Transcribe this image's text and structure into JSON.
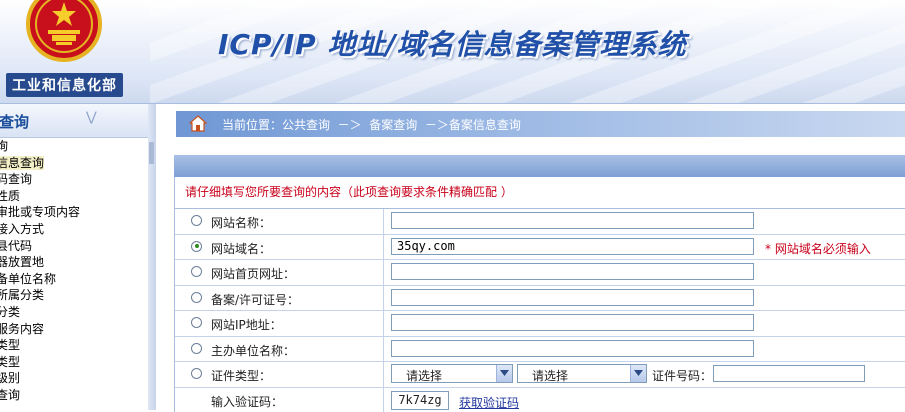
{
  "header": {
    "ministry": "工业和信息化部",
    "system_title": "ICP/IP 地址/域名信息备案管理系统"
  },
  "sidebar": {
    "title": "查询",
    "items": [
      {
        "label": "询"
      },
      {
        "label": "信息查询",
        "active": true
      },
      {
        "label": "码查询"
      },
      {
        "label": "性质"
      },
      {
        "label": "审批或专项内容"
      },
      {
        "label": "接入方式"
      },
      {
        "label": "县代码"
      },
      {
        "label": "器放置地"
      },
      {
        "label": "备单位名称"
      },
      {
        "label": "所属分类"
      },
      {
        "label": "分类"
      },
      {
        "label": "服务内容"
      },
      {
        "label": "类型"
      },
      {
        "label": "类型"
      },
      {
        "label": "级别"
      },
      {
        "label": "查询"
      }
    ]
  },
  "breadcrumb": {
    "text": "当前位置：公共查询  －＞  备案查询  －＞备案信息查询"
  },
  "form": {
    "notice": "请仔细填写您所要查询的内容（此项查询要求条件精确匹配 ）",
    "fields": [
      {
        "label": "网站名称：",
        "value": "",
        "selected": false
      },
      {
        "label": "网站域名：",
        "value": "35qy.com",
        "selected": true,
        "required_note": "* 网站域名必须输入"
      },
      {
        "label": "网站首页网址：",
        "value": "",
        "selected": false
      },
      {
        "label": "备案/许可证号：",
        "value": "",
        "selected": false
      },
      {
        "label": "网站IP地址：",
        "value": "",
        "selected": false
      },
      {
        "label": "主办单位名称：",
        "value": "",
        "selected": false
      }
    ],
    "cert_row": {
      "label": "证件类型：",
      "select1": "请选择",
      "select2": "请选择",
      "number_label": "证件号码：",
      "number_value": ""
    },
    "captcha_row": {
      "label": "输入验证码：",
      "code": "7k74zg",
      "link": "获取验证码"
    }
  },
  "colors": {
    "accent": "#2150a8",
    "required": "#c8001a",
    "link": "#23389e"
  }
}
